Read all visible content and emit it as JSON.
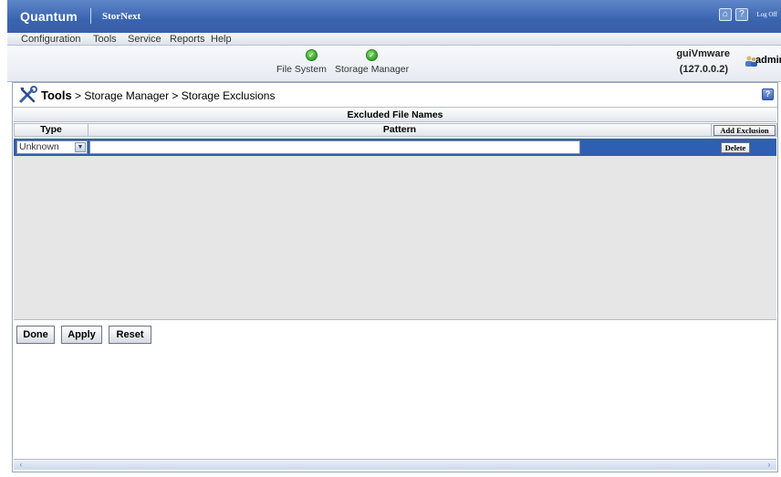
{
  "brand": {
    "name": "Quantum",
    "product": "StorNext",
    "logoff_label": "Log Off"
  },
  "menu": {
    "items": [
      "Configuration",
      "Tools",
      "Service",
      "Reports",
      "Help"
    ]
  },
  "status": {
    "items": [
      {
        "label": "File System",
        "state": "ok",
        "color": "#33a32a"
      },
      {
        "label": "Storage Manager",
        "state": "ok",
        "color": "#33a32a"
      }
    ],
    "host": "guiVmware",
    "ip": "(127.0.0.2)",
    "user": "admin"
  },
  "page": {
    "breadcrumb_root": "Tools",
    "breadcrumb_rest": "> Storage Manager > Storage Exclusions"
  },
  "grid": {
    "title": "Excluded File Names",
    "columns": {
      "type": "Type",
      "pattern": "Pattern"
    },
    "add_label": "Add Exclusion",
    "rows": [
      {
        "type": "Unknown",
        "pattern": "",
        "delete_label": "Delete"
      }
    ]
  },
  "actions": {
    "done": "Done",
    "apply": "Apply",
    "reset": "Reset"
  },
  "colors": {
    "header_blue": "#3a64b0",
    "selected_row": "#2f5fb2"
  }
}
